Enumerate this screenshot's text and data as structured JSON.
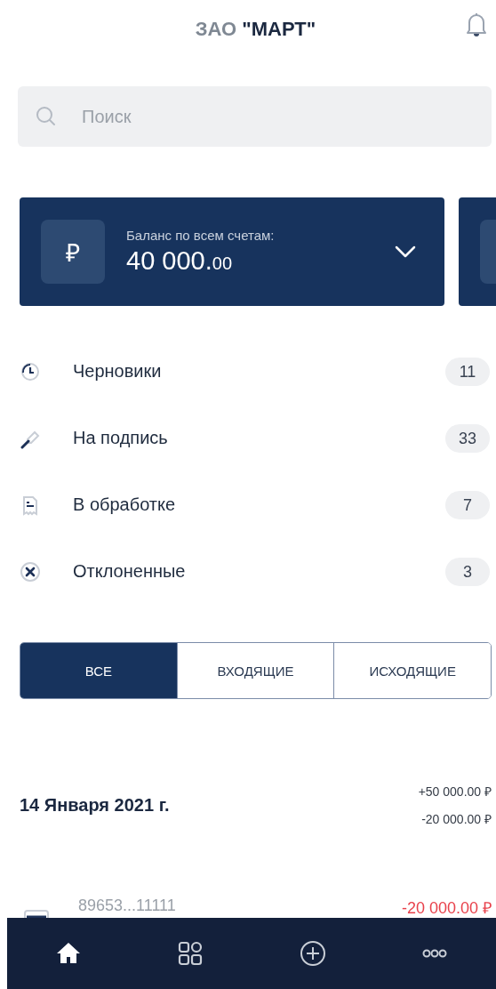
{
  "header": {
    "title": "ЗАО **\"МАРТ\"**"
  },
  "search": {
    "placeholder": "Поиск"
  },
  "balance_cards": [
    {
      "label": "Баланс по всем счетам:",
      "currency": "₽",
      "amount": "40 000.",
      "amount_fraction": "00"
    }
  ],
  "document_statuses": [
    {
      "kind": "draft",
      "label": "Черновики",
      "count": "11"
    },
    {
      "kind": "sign",
      "label": "На подпись",
      "count": "33"
    },
    {
      "kind": "processing",
      "label": "В обработке",
      "count": "7"
    },
    {
      "kind": "rejected",
      "label": "Отклоненные",
      "count": "3"
    }
  ],
  "tabs": [
    {
      "label": "ВСЕ",
      "selected": true
    },
    {
      "label": "ВХОДЯЩИЕ",
      "selected": false
    },
    {
      "label": "ИСХОДЯЩИЕ",
      "selected": false
    }
  ],
  "day_groups": [
    {
      "date": "14 Января 2021 г.",
      "income": "+50 000.00 ₽",
      "expense": "-20 000.00 ₽",
      "transactions": [
        {
          "account": "89653...11111",
          "amount": "-20 000.00 ₽"
        }
      ]
    }
  ],
  "bottom_nav": [
    {
      "kind": "home",
      "selected": true
    },
    {
      "kind": "apps",
      "selected": false
    },
    {
      "kind": "add",
      "selected": false
    },
    {
      "kind": "more",
      "selected": false
    }
  ]
}
